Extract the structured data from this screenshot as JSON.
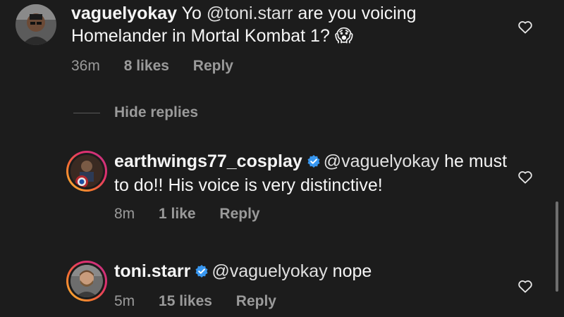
{
  "comments": [
    {
      "username": "vaguelyokay",
      "verified": false,
      "text_prefix": "Yo ",
      "mention": "@toni.starr",
      "text_suffix": " are you voicing Homelander in Mortal Kombat 1?",
      "emoji": "😱",
      "time": "36m",
      "likes": "8 likes",
      "reply": "Reply"
    },
    {
      "username": "earthwings77_cosplay",
      "verified": true,
      "mention": "@vaguelyokay",
      "text_suffix": " he must to do!! His voice is very distinctive!",
      "time": "8m",
      "likes": "1 like",
      "reply": "Reply"
    },
    {
      "username": "toni.starr",
      "verified": true,
      "mention": "@vaguelyokay",
      "text_suffix": " nope",
      "time": "5m",
      "likes": "15 likes",
      "reply": "Reply"
    }
  ],
  "hide_replies": "Hide replies",
  "icons": {
    "like": "heart-outline-icon",
    "verified": "verified-badge-icon"
  },
  "colors": {
    "background": "#1c1c1c",
    "text": "#f5f5f5",
    "meta": "#9a9a9a",
    "verified": "#3897f0"
  }
}
